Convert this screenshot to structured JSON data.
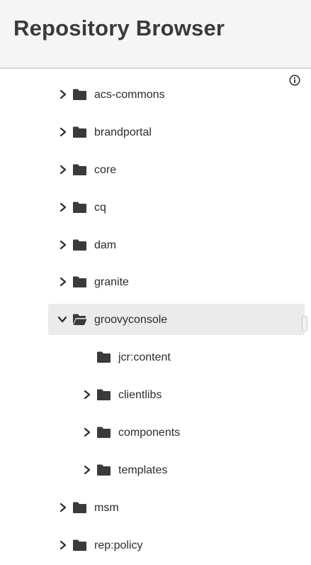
{
  "header": {
    "title": "Repository Browser"
  },
  "tree": {
    "info_icon": "info-icon",
    "items": [
      {
        "label": "acs-commons",
        "expanded": false,
        "has_children": true,
        "icon": "folder-icon"
      },
      {
        "label": "brandportal",
        "expanded": false,
        "has_children": true,
        "icon": "folder-icon"
      },
      {
        "label": "core",
        "expanded": false,
        "has_children": true,
        "icon": "folder-icon"
      },
      {
        "label": "cq",
        "expanded": false,
        "has_children": true,
        "icon": "folder-icon"
      },
      {
        "label": "dam",
        "expanded": false,
        "has_children": true,
        "icon": "folder-icon"
      },
      {
        "label": "granite",
        "expanded": false,
        "has_children": true,
        "icon": "folder-icon"
      },
      {
        "label": "groovyconsole",
        "expanded": true,
        "selected": true,
        "has_children": true,
        "icon": "folder-open-icon",
        "children": [
          {
            "label": "jcr:content",
            "expanded": false,
            "has_children": false,
            "icon": "folder-icon"
          },
          {
            "label": "clientlibs",
            "expanded": false,
            "has_children": true,
            "icon": "folder-icon"
          },
          {
            "label": "components",
            "expanded": false,
            "has_children": true,
            "icon": "folder-icon"
          },
          {
            "label": "templates",
            "expanded": false,
            "has_children": true,
            "icon": "folder-icon"
          }
        ]
      },
      {
        "label": "msm",
        "expanded": false,
        "has_children": true,
        "icon": "folder-icon"
      },
      {
        "label": "rep:policy",
        "expanded": false,
        "has_children": true,
        "icon": "folder-icon"
      }
    ]
  },
  "colors": {
    "header_bg": "#f5f5f5",
    "selected_row_bg": "#ebebeb",
    "icon": "#2c2c2c"
  }
}
